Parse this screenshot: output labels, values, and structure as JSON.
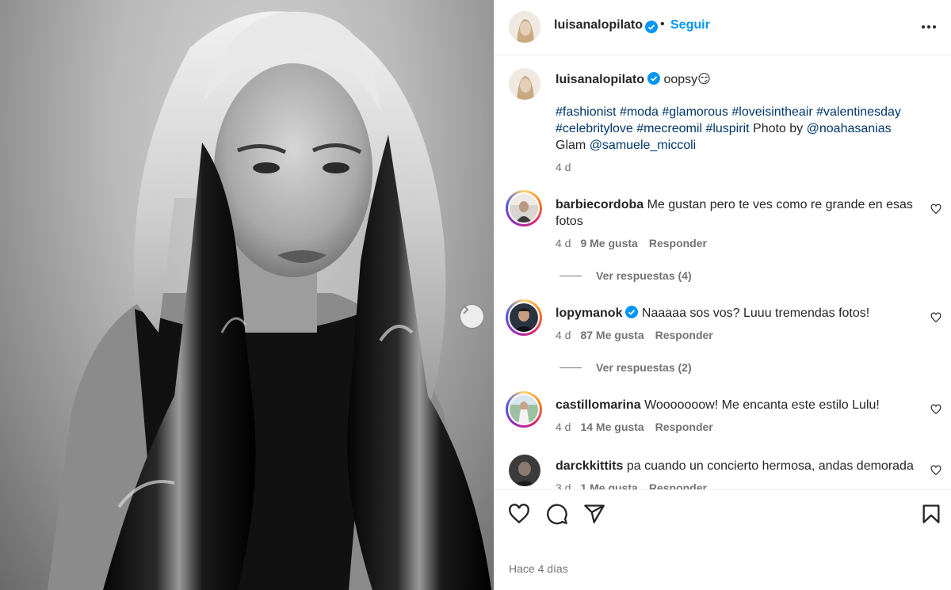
{
  "post": {
    "author": "luisanalopilato",
    "follow_label": "Seguir",
    "separator": "•",
    "more_icon": "more-horizontal-icon",
    "caption_text": "oopsy",
    "caption_emoji": "😏",
    "caption_tags_line1": [
      "#fashionist",
      "#moda",
      "#glamorous",
      "#loveisintheair",
      "#valentinesday"
    ],
    "caption_line2_tags": [
      "#celebritylove",
      "#mecreomil",
      "#luspirit"
    ],
    "caption_line2_text": "Photo by",
    "caption_line2_mention": "@noahasanias",
    "caption_line3_text": "Glam",
    "caption_line3_mention": "@samuele_miccoli",
    "caption_time": "4 d"
  },
  "comments": [
    {
      "user": "barbiecordoba",
      "verified": false,
      "text_line1": "Me gustan pero te ves como re grande en esas",
      "text_line2": "fotos",
      "time": "4 d",
      "likes": "9 Me gusta",
      "reply": "Responder",
      "view_replies": "Ver respuestas (4)"
    },
    {
      "user": "lopymanok",
      "verified": true,
      "text_line1": "Naaaaa sos vos? Luuu tremendas fotos!",
      "time": "4 d",
      "likes": "87 Me gusta",
      "reply": "Responder",
      "view_replies": "Ver respuestas (2)"
    },
    {
      "user": "castillomarina",
      "verified": false,
      "text_line1": "Wooooooow! Me encanta este estilo Lulu!",
      "time": "4 d",
      "likes": "14 Me gusta",
      "reply": "Responder"
    },
    {
      "user": "darckkittits",
      "verified": false,
      "text_line1": "pa cuando un concierto hermosa, andas demorada",
      "time": "3 d",
      "likes": "1 Me gusta",
      "reply": "Responder"
    }
  ],
  "actions": {
    "icons": [
      "heart-icon",
      "comment-icon",
      "share-icon",
      "bookmark-icon"
    ],
    "posted_ago": "Hace 4 días"
  },
  "colors": {
    "link": "#0095f6",
    "hashtag": "#00376b",
    "muted": "#737373",
    "verified": "#0095f6"
  }
}
